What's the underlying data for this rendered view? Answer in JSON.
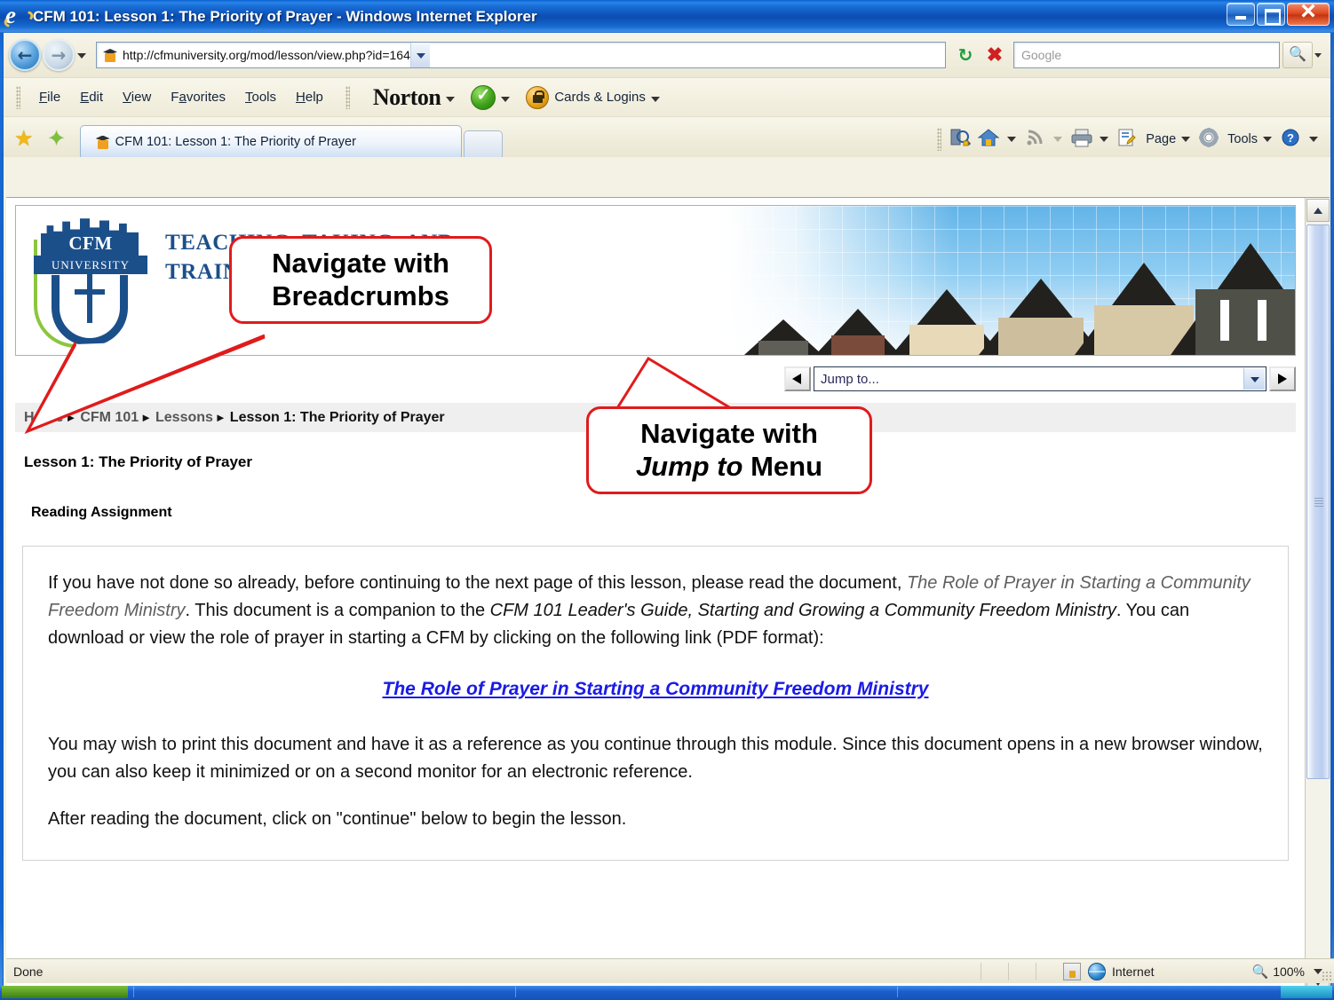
{
  "window": {
    "title": "CFM 101: Lesson 1: The Priority of Prayer - Windows Internet Explorer",
    "minimize_label": "Minimize",
    "maximize_label": "Restore",
    "close_label": "Close"
  },
  "address_bar": {
    "url": "http://cfmuniversity.org/mod/lesson/view.php?id=164",
    "site_icon": "moodle-icon",
    "back_icon": "back-arrow-icon",
    "forward_icon": "forward-arrow-icon",
    "history_dropdown_icon": "chevron-down-icon",
    "refresh_icon": "refresh-icon",
    "stop_icon": "stop-icon",
    "search_placeholder": "Google",
    "search_go_icon": "search-icon",
    "search_provider_dropdown_icon": "chevron-down-icon"
  },
  "menu_bar": {
    "items": [
      {
        "label": "File",
        "accel": "F"
      },
      {
        "label": "Edit",
        "accel": "E"
      },
      {
        "label": "View",
        "accel": "V"
      },
      {
        "label": "Favorites",
        "accel": "a"
      },
      {
        "label": "Tools",
        "accel": "T"
      },
      {
        "label": "Help",
        "accel": "H"
      }
    ],
    "norton_label": "Norton",
    "norton_status_icon": "green-check-icon",
    "cards_logins_label": "Cards & Logins",
    "cards_logins_icon": "lock-icon"
  },
  "tab_bar": {
    "favorites_icon": "star-icon",
    "add_favorites_icon": "star-plus-icon",
    "tab_title": "CFM 101: Lesson 1: The Priority of Prayer",
    "tab_icon": "moodle-icon",
    "new_tab_label": "",
    "command_bar": [
      {
        "name": "safety-suggested-sites-icon",
        "label": ""
      },
      {
        "name": "home-icon",
        "label": ""
      },
      {
        "name": "feeds-icon",
        "label": ""
      },
      {
        "name": "print-icon",
        "label": ""
      },
      {
        "name": "page-icon",
        "label": "Page"
      },
      {
        "name": "tools-gear-icon",
        "label": "Tools"
      },
      {
        "name": "help-icon",
        "label": ""
      }
    ],
    "page_label": "Page",
    "tools_label": "Tools"
  },
  "page": {
    "banner": {
      "logo_name": "CFM",
      "logo_sub": "UNIVERSITY",
      "tagline_line1": "TEACHING, TAKING, AND",
      "tagline_line2": "TRAINING A NATION.",
      "photo_alt": "row-of-houses-photo"
    },
    "jump_nav": {
      "prev_label": "Previous",
      "next_label": "Next",
      "select_value": "Jump to...",
      "dropdown_icon": "chevron-down-icon"
    },
    "breadcrumbs": [
      {
        "label": "Home",
        "current": false
      },
      {
        "label": "CFM 101",
        "current": false
      },
      {
        "label": "Lessons",
        "current": false
      },
      {
        "label": "Lesson 1: The Priority of Prayer",
        "current": true
      }
    ],
    "breadcrumb_separator": "►",
    "lesson_title": "Lesson 1: The Priority of Prayer",
    "section_heading": "Reading Assignment",
    "body": {
      "p1_a": "If you have not done so already, before continuing to the next page of this lesson, please read the document, ",
      "p1_doc_title": "The Role of Prayer in Starting a Community Freedom Ministry",
      "p1_b": ".  This document is a companion to the ",
      "p1_guide_title": "CFM 101 Leader's Guide, Starting and Growing a Community Freedom Ministry",
      "p1_c": ".  You can download or view the role of prayer in starting a CFM by clicking on the following link (PDF format):",
      "link_text": "The Role of Prayer in Starting a Community Freedom Ministry",
      "p2": "You may wish to print this document and have it as a reference as you continue through this module.  Since this document opens in a new browser window, you can also keep it minimized or on a second monitor for an electronic reference.",
      "p3": "After reading the document, click on \"continue\" below to begin the lesson."
    },
    "scrollbar": {
      "up_icon": "chevron-up-icon",
      "down_icon": "chevron-down-icon",
      "thumb_name": "scroll-thumb"
    }
  },
  "callouts": [
    {
      "name": "breadcrumbs-callout",
      "line1": "Navigate with",
      "line2": "Breadcrumbs",
      "line2_italic": false
    },
    {
      "name": "jump-to-callout",
      "line1": "Navigate with",
      "line2_italic_part": "Jump to",
      "line2_rest": " Menu"
    }
  ],
  "status_bar": {
    "status_text": "Done",
    "zone_icon": "security-zone-icon",
    "internet_icon": "globe-icon",
    "zone_label": "Internet",
    "zoom_icon": "zoom-icon",
    "zoom_level": "100%",
    "zoom_dropdown_icon": "chevron-down-icon"
  },
  "colors": {
    "title_blue": "#0d52b8",
    "chrome_cream": "#f4f2e4",
    "callout_red": "#e01b1b",
    "link_blue": "#1a1ae6",
    "logo_navy": "#1b4f8a",
    "logo_green": "#8cc63f"
  }
}
